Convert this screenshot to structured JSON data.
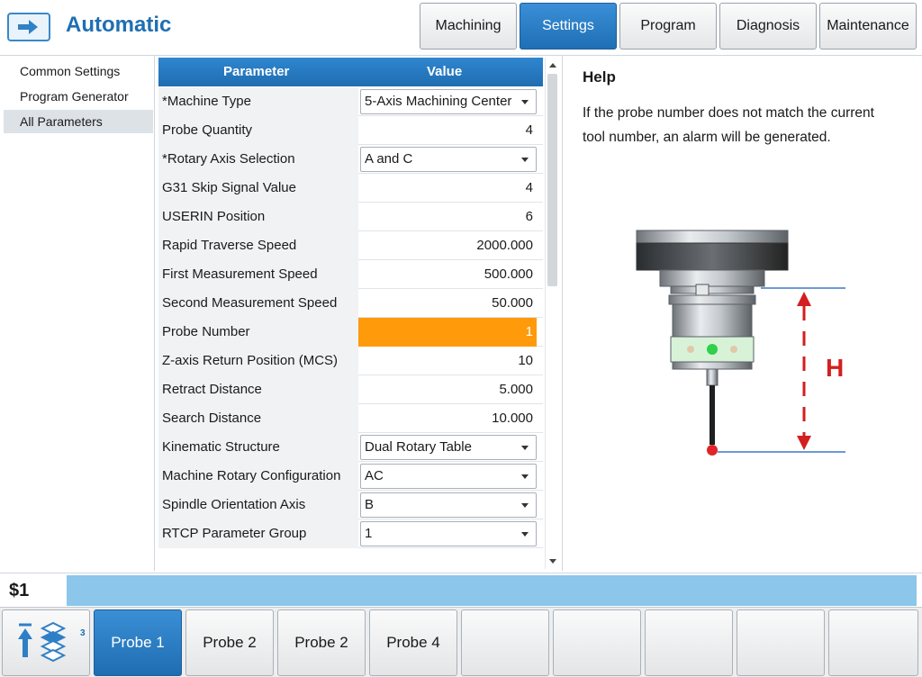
{
  "header": {
    "mode_title": "Automatic",
    "mode_icon": "arrow-right-box-icon",
    "tabs": [
      {
        "label": "Machining",
        "active": false
      },
      {
        "label": "Settings",
        "active": true
      },
      {
        "label": "Program",
        "active": false
      },
      {
        "label": "Diagnosis",
        "active": false
      },
      {
        "label": "Maintenance",
        "active": false
      }
    ]
  },
  "sidebar": {
    "items": [
      {
        "label": "Common Settings",
        "active": false
      },
      {
        "label": "Program Generator",
        "active": false
      },
      {
        "label": "All Parameters",
        "active": true
      }
    ]
  },
  "table": {
    "col_parameter": "Parameter",
    "col_value": "Value",
    "rows": [
      {
        "name": "*Machine Type",
        "value": "5-Axis Machining Center",
        "dropdown": true
      },
      {
        "name": "Probe Quantity",
        "value": "4",
        "dropdown": false
      },
      {
        "name": "*Rotary Axis Selection",
        "value": "A and C",
        "dropdown": true
      },
      {
        "name": "G31 Skip Signal Value",
        "value": "4",
        "dropdown": false
      },
      {
        "name": "USERIN Position",
        "value": "6",
        "dropdown": false
      },
      {
        "name": "Rapid Traverse Speed",
        "value": "2000.000",
        "dropdown": false
      },
      {
        "name": "First Measurement Speed",
        "value": "500.000",
        "dropdown": false
      },
      {
        "name": "Second Measurement Speed",
        "value": "50.000",
        "dropdown": false
      },
      {
        "name": "Probe Number",
        "value": "1",
        "dropdown": false,
        "highlighted": true
      },
      {
        "name": "Z-axis Return Position (MCS)",
        "value": "10",
        "dropdown": false
      },
      {
        "name": "Retract Distance",
        "value": "5.000",
        "dropdown": false
      },
      {
        "name": "Search Distance",
        "value": "10.000",
        "dropdown": false
      },
      {
        "name": "Kinematic Structure",
        "value": "Dual Rotary Table",
        "dropdown": true
      },
      {
        "name": "Machine Rotary Configuration",
        "value": "AC",
        "dropdown": true
      },
      {
        "name": "Spindle Orientation Axis",
        "value": "B",
        "dropdown": true
      },
      {
        "name": "RTCP Parameter Group",
        "value": "1",
        "dropdown": true
      }
    ]
  },
  "help": {
    "title": "Help",
    "text": "If the probe number does not match the current tool number, an alarm will be generated.",
    "figure_label": "H",
    "colors": {
      "dimension_arrow": "#d31f1f",
      "reference_line": "#3a78c8",
      "indicator_light": "#2fd04a",
      "stylus_tip": "#e0242a"
    }
  },
  "status": {
    "channel": "$1",
    "message": ""
  },
  "softkeys": {
    "layer_icon": "layers-icon",
    "up_icon": "upload-arrow-icon",
    "layer_count": "3",
    "items": [
      {
        "label": "Probe 1",
        "active": true
      },
      {
        "label": "Probe 2",
        "active": false
      },
      {
        "label": "Probe 2",
        "active": false
      },
      {
        "label": "Probe 4",
        "active": false
      },
      {
        "label": "",
        "active": false
      },
      {
        "label": "",
        "active": false
      },
      {
        "label": "",
        "active": false
      },
      {
        "label": "",
        "active": false
      },
      {
        "label": "",
        "active": false
      }
    ]
  },
  "theme": {
    "accent": "#1f6fb2",
    "highlight": "#ff9a0a",
    "message_bar": "#8cc6ea"
  }
}
